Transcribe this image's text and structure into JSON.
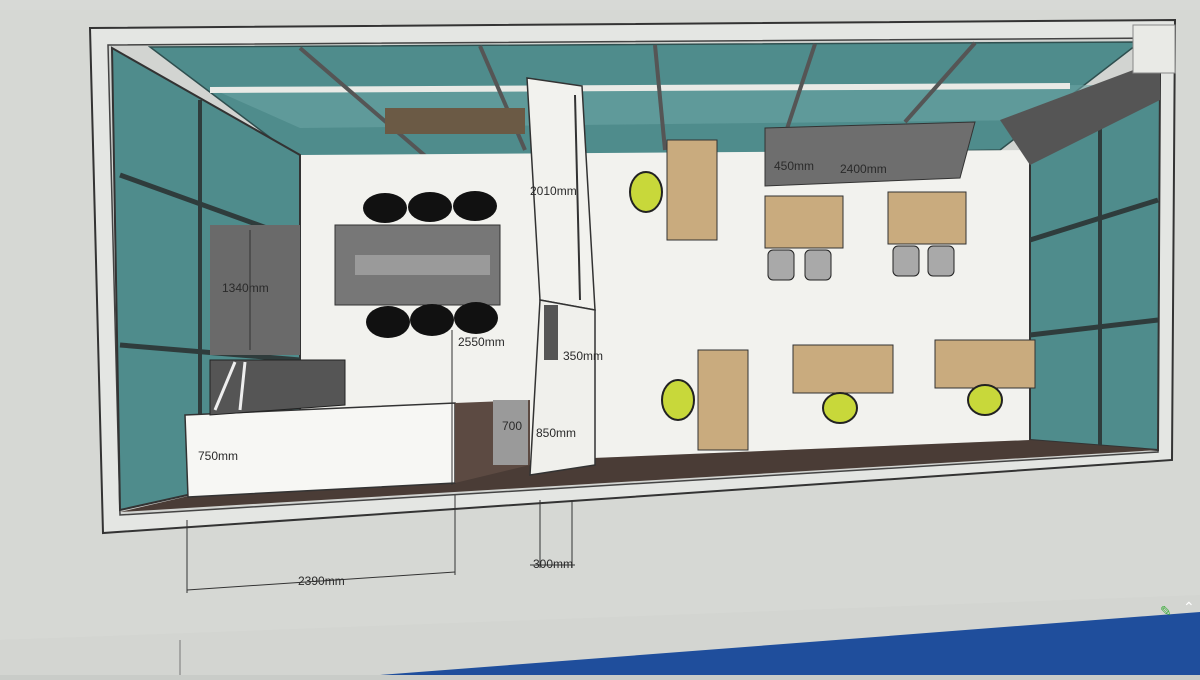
{
  "dimensions": {
    "d_2400": "2400mm",
    "d_450": "450mm",
    "d_2010": "2010mm",
    "d_1340": "1340mm",
    "d_2550": "2550mm",
    "d_350": "350mm",
    "d_700": "700",
    "d_850": "850mm",
    "d_750": "750mm",
    "d_2390": "2390mm",
    "d_300": "300mm"
  },
  "icons": {
    "tray_pen": "pen-icon",
    "tray_up": "chevron-up-icon"
  },
  "colors": {
    "glass": "#4f8c8c",
    "floor": "#4a3c36",
    "wall": "#f2f2ee",
    "desk_wood": "#c9ab7e",
    "chair_yellow": "#c8d83a",
    "taskbar_blue": "#1f4e9c"
  }
}
